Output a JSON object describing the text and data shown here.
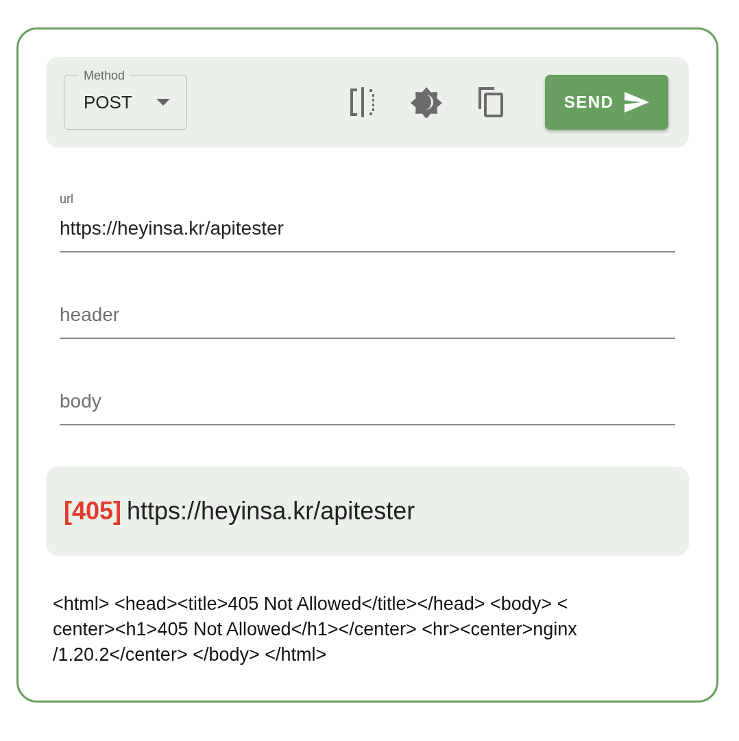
{
  "toolbar": {
    "method": {
      "label": "Method",
      "value": "POST"
    },
    "send_button": "SEND"
  },
  "fields": [
    {
      "label": "url",
      "value": "https://heyinsa.kr/apitester"
    },
    {
      "placeholder": "header"
    },
    {
      "placeholder": "body"
    }
  ],
  "response": {
    "status": "[405]",
    "url": "https://heyinsa.kr/apitester"
  },
  "response_body_lines": [
    "<html> <head><title>405 Not Allowed</title></head> <body> <",
    "center><h1>405 Not Allowed</h1></center> <hr><center>nginx",
    "/1.20.2</center> </body> </html>"
  ]
}
